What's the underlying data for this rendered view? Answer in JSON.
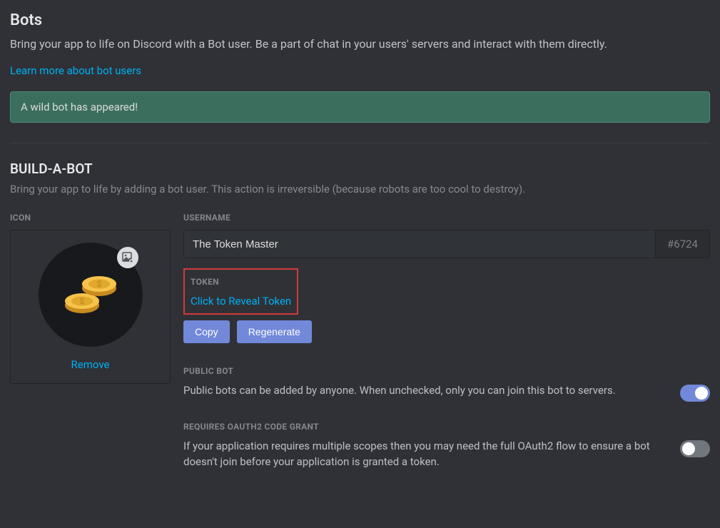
{
  "page": {
    "title": "Bots",
    "description": "Bring your app to life on Discord with a Bot user. Be a part of chat in your users' servers and interact with them directly.",
    "learn_more": "Learn more about bot users"
  },
  "banner": {
    "text": "A wild bot has appeared!"
  },
  "build": {
    "title": "BUILD-A-BOT",
    "description": "Bring your app to life by adding a bot user. This action is irreversible (because robots are too cool to destroy)."
  },
  "icon": {
    "label": "ICON",
    "remove": "Remove"
  },
  "username": {
    "label": "USERNAME",
    "value": "The Token Master",
    "discriminator": "#6724"
  },
  "token": {
    "label": "TOKEN",
    "reveal": "Click to Reveal Token",
    "copy": "Copy",
    "regenerate": "Regenerate"
  },
  "public_bot": {
    "label": "PUBLIC BOT",
    "description": "Public bots can be added by anyone. When unchecked, only you can join this bot to servers."
  },
  "oauth": {
    "label": "REQUIRES OAUTH2 CODE GRANT",
    "description": "If your application requires multiple scopes then you may need the full OAuth2 flow to ensure a bot doesn't join before your application is granted a token."
  }
}
